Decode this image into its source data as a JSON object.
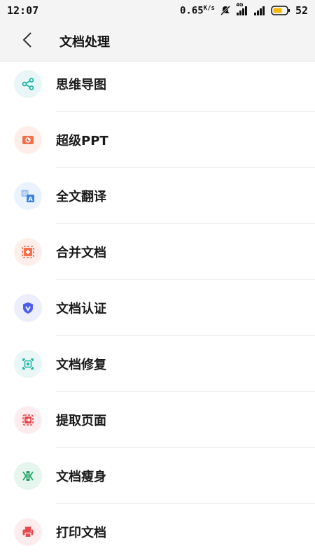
{
  "status_bar": {
    "time": "12:07",
    "net_speed": "0.65",
    "net_unit": "K/s",
    "network_type": "4G",
    "battery_level": "52",
    "icons": [
      "mute-icon",
      "signal-icon",
      "battery-icon"
    ]
  },
  "header": {
    "back_icon": "chevron-left-icon",
    "title": "文档处理"
  },
  "items": [
    {
      "label": "思维导图",
      "icon": "mindmap-icon",
      "bg": "#e8f7f6",
      "color": "#1fb5a8"
    },
    {
      "label": "超级PPT",
      "icon": "ppt-icon",
      "bg": "#fdeee9",
      "color": "#f0704a"
    },
    {
      "label": "全文翻译",
      "icon": "translate-icon",
      "bg": "#eaf3fd",
      "color": "#3b82e6"
    },
    {
      "label": "合并文档",
      "icon": "merge-icon",
      "bg": "#fdeee9",
      "color": "#f0704a"
    },
    {
      "label": "文档认证",
      "icon": "shield-check-icon",
      "bg": "#eceefd",
      "color": "#4e5ff0"
    },
    {
      "label": "文档修复",
      "icon": "repair-icon",
      "bg": "#e8f7f6",
      "color": "#1fb5a8"
    },
    {
      "label": "提取页面",
      "icon": "extract-page-icon",
      "bg": "#fdeced",
      "color": "#e8474d"
    },
    {
      "label": "文档瘦身",
      "icon": "compress-icon",
      "bg": "#e6f6ee",
      "color": "#23a566"
    },
    {
      "label": "打印文档",
      "icon": "printer-icon",
      "bg": "#fdeced",
      "color": "#e8474d"
    }
  ]
}
